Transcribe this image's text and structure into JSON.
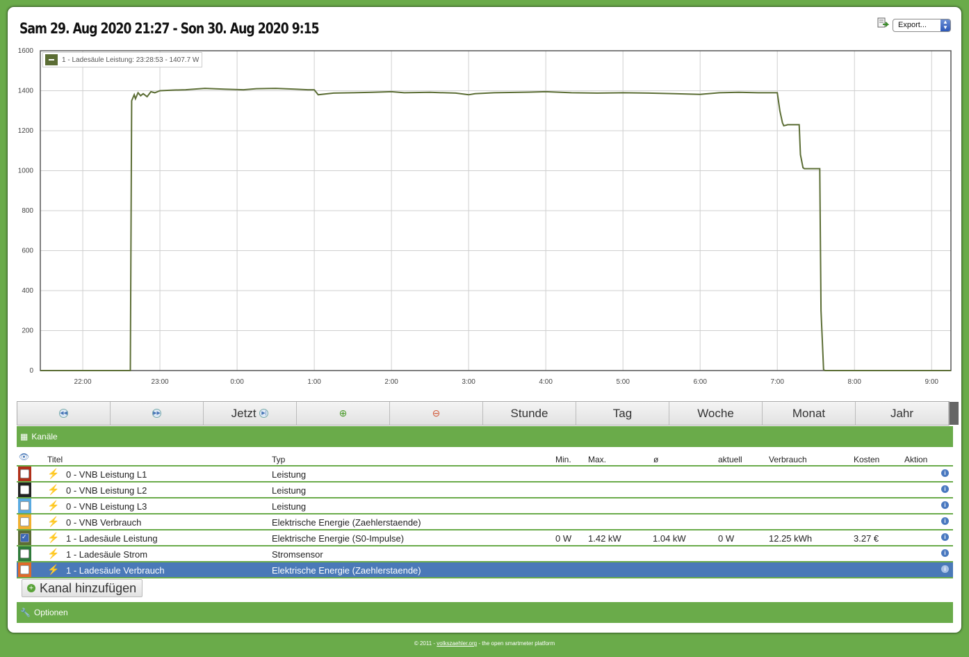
{
  "header": {
    "title": "Sam 29. Aug 2020 21:27 - Son 30. Aug 2020 9:15",
    "export_label": "Export..."
  },
  "chart_data": {
    "type": "line",
    "legend": "1 - Ladesäule Leistung: 23:28:53 - 1407.7 W",
    "line_color": "#5b6d34",
    "ylim": [
      0,
      1600
    ],
    "y_ticks": [
      0,
      200,
      400,
      600,
      800,
      1000,
      1200,
      1400,
      1600
    ],
    "x_range_hours": [
      21.45,
      9.25
    ],
    "x_tick_labels": [
      "22:00",
      "23:00",
      "0:00",
      "1:00",
      "2:00",
      "3:00",
      "4:00",
      "5:00",
      "6:00",
      "7:00",
      "8:00",
      "9:00"
    ],
    "grid": true,
    "series": [
      {
        "x": [
          "21:27",
          "22:37",
          "22:38",
          "22:40",
          "22:41",
          "22:43",
          "22:45",
          "22:47",
          "22:50",
          "22:53",
          "22:56",
          "23:00",
          "23:10",
          "23:20",
          "23:35",
          "23:50",
          "0:05",
          "0:15",
          "0:30",
          "0:45",
          "0:55",
          "1:00",
          "1:03",
          "1:15",
          "1:30",
          "1:45",
          "2:00",
          "2:10",
          "2:30",
          "2:50",
          "3:00",
          "3:05",
          "3:20",
          "3:40",
          "4:00",
          "4:20",
          "4:40",
          "5:00",
          "5:20",
          "5:40",
          "6:00",
          "6:15",
          "6:30",
          "6:45",
          "7:00",
          "7:02",
          "7:04",
          "7:05",
          "7:07",
          "7:08",
          "7:17",
          "7:18",
          "7:20",
          "7:21",
          "7:33",
          "7:34",
          "7:36",
          "7:37",
          "9:15"
        ],
        "y": [
          0,
          0,
          1350,
          1380,
          1360,
          1390,
          1375,
          1385,
          1370,
          1395,
          1390,
          1400,
          1403,
          1405,
          1412,
          1408,
          1405,
          1410,
          1412,
          1408,
          1405,
          1405,
          1380,
          1388,
          1390,
          1392,
          1395,
          1390,
          1392,
          1388,
          1380,
          1385,
          1390,
          1392,
          1395,
          1390,
          1388,
          1390,
          1388,
          1385,
          1382,
          1390,
          1392,
          1390,
          1390,
          1300,
          1240,
          1225,
          1228,
          1230,
          1230,
          1080,
          1015,
          1010,
          1010,
          300,
          5,
          0,
          0
        ]
      }
    ]
  },
  "nav": {
    "buttons": [
      "",
      "",
      "Jetzt",
      "",
      "",
      "Stunde",
      "Tag",
      "Woche",
      "Monat",
      "Jahr"
    ]
  },
  "channels": {
    "title": "Kanäle",
    "headers": {
      "titel": "Titel",
      "typ": "Typ",
      "min": "Min.",
      "max": "Max.",
      "avg": "ø",
      "aktuell": "aktuell",
      "verbrauch": "Verbrauch",
      "kosten": "Kosten",
      "aktion": "Aktion"
    },
    "rows": [
      {
        "color": "#b0301a",
        "checked": false,
        "title": "0 - VNB Leistung L1",
        "type": "Leistung",
        "min": "",
        "max": "",
        "avg": "",
        "aktuell": "",
        "verbrauch": "",
        "kosten": ""
      },
      {
        "color": "#222222",
        "checked": false,
        "title": "0 - VNB Leistung L2",
        "type": "Leistung",
        "min": "",
        "max": "",
        "avg": "",
        "aktuell": "",
        "verbrauch": "",
        "kosten": ""
      },
      {
        "color": "#5aaae0",
        "checked": false,
        "title": "0 - VNB Leistung L3",
        "type": "Leistung",
        "min": "",
        "max": "",
        "avg": "",
        "aktuell": "",
        "verbrauch": "",
        "kosten": ""
      },
      {
        "color": "#f0b030",
        "checked": false,
        "title": "0 - VNB Verbrauch",
        "type": "Elektrische Energie (Zaehlerstaende)",
        "min": "",
        "max": "",
        "avg": "",
        "aktuell": "",
        "verbrauch": "",
        "kosten": ""
      },
      {
        "color": "#5b6d34",
        "checked": true,
        "title": "1 - Ladesäule Leistung",
        "type": "Elektrische Energie (S0-Impulse)",
        "min": "0 W",
        "max": "1.42 kW",
        "avg": "1.04 kW",
        "aktuell": "0 W",
        "verbrauch": "12.25 kWh",
        "kosten": "3.27 €"
      },
      {
        "color": "#2f7a3a",
        "checked": false,
        "title": "1 - Ladesäule Strom",
        "type": "Stromsensor",
        "min": "",
        "max": "",
        "avg": "",
        "aktuell": "",
        "verbrauch": "",
        "kosten": ""
      },
      {
        "color": "#e06a2a",
        "checked": false,
        "title": "1 - Ladesäule Verbrauch",
        "type": "Elektrische Energie (Zaehlerstaende)",
        "min": "",
        "max": "",
        "avg": "",
        "aktuell": "",
        "verbrauch": "",
        "kosten": "",
        "selected": true
      }
    ],
    "add_label": "Kanal hinzufügen"
  },
  "options": {
    "title": "Optionen"
  },
  "footer": {
    "prefix": "© 2011 - ",
    "link": "volkszaehler.org",
    "suffix": " - the open smartmeter platform"
  }
}
